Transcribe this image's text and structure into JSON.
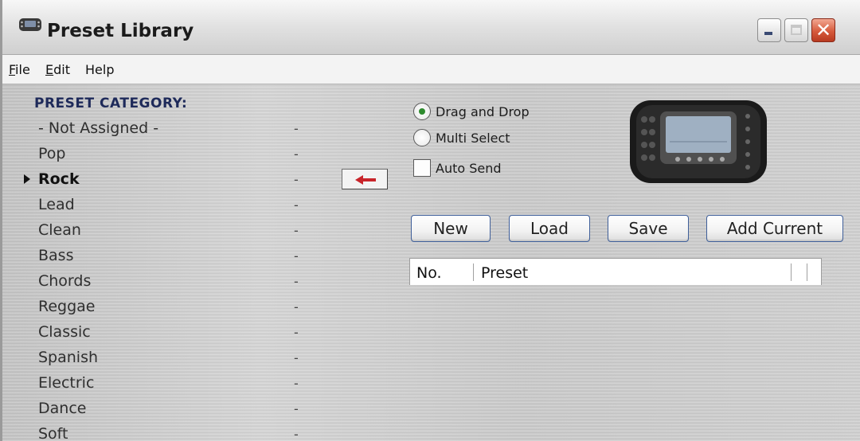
{
  "window": {
    "title": "Preset Library"
  },
  "menu": {
    "items": [
      {
        "label": "File",
        "mnemonic": "F",
        "rest": "ile"
      },
      {
        "label": "Edit",
        "mnemonic": "E",
        "rest": "dit"
      },
      {
        "label": "Help",
        "mnemonic": "",
        "rest": "Help"
      }
    ]
  },
  "category": {
    "header": "PRESET CATEGORY:",
    "selected": "Rock",
    "items": [
      {
        "label": "- Not Assigned -",
        "value": "-"
      },
      {
        "label": "Pop",
        "value": "-"
      },
      {
        "label": "Rock",
        "value": "-"
      },
      {
        "label": "Lead",
        "value": "-"
      },
      {
        "label": "Clean",
        "value": "-"
      },
      {
        "label": "Bass",
        "value": "-"
      },
      {
        "label": "Chords",
        "value": "-"
      },
      {
        "label": "Reggae",
        "value": "-"
      },
      {
        "label": "Classic",
        "value": "-"
      },
      {
        "label": "Spanish",
        "value": "-"
      },
      {
        "label": "Electric",
        "value": "-"
      },
      {
        "label": "Dance",
        "value": "-"
      },
      {
        "label": "Soft",
        "value": "-"
      }
    ]
  },
  "options": {
    "drag_drop": "Drag and Drop",
    "multi_select": "Multi Select",
    "auto_send": "Auto Send",
    "selected_mode": "Drag and Drop",
    "auto_send_checked": false
  },
  "buttons": {
    "new": "New",
    "load": "Load",
    "save": "Save",
    "add_current": "Add Current"
  },
  "preset_list": {
    "columns": [
      "No.",
      "Preset"
    ]
  },
  "colors": {
    "header_text": "#1e2a5a",
    "arrow": "#c8242a",
    "radio_dot": "#2e8b2e"
  }
}
